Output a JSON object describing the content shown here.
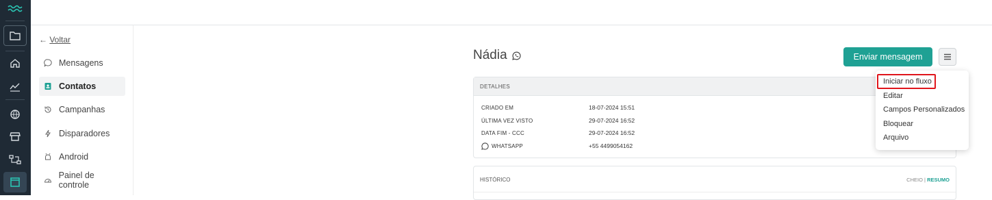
{
  "back": {
    "arrow": "←",
    "label": "Voltar"
  },
  "nav": [
    {
      "label": "Mensagens",
      "icon": "chat-bubble-icon",
      "active": false
    },
    {
      "label": "Contatos",
      "icon": "contact-card-icon",
      "active": true
    },
    {
      "label": "Campanhas",
      "icon": "history-icon",
      "active": false
    },
    {
      "label": "Disparadores",
      "icon": "lightning-icon",
      "active": false
    },
    {
      "label": "Android",
      "icon": "android-icon",
      "active": false
    },
    {
      "label": "Painel de controle",
      "icon": "dashboard-gauge-icon",
      "active": false
    }
  ],
  "contact": {
    "name": "Nádia"
  },
  "actions": {
    "send_label": "Enviar mensagem"
  },
  "details": {
    "header": "DETALHES",
    "rows": [
      {
        "label": "CRIADO EM",
        "value": "18-07-2024 15:51"
      },
      {
        "label": "ÚLTIMA VEZ VISTO",
        "value": "29-07-2024 16:52"
      },
      {
        "label": "DATA FIM - CCC",
        "value": "29-07-2024 16:52"
      },
      {
        "label": "WHATSAPP",
        "value": "+55 4499054162"
      }
    ]
  },
  "history": {
    "header": "HISTÓRICO",
    "full": "CHEIO",
    "sep": "|",
    "summary": "RESUMO"
  },
  "menu": {
    "items": [
      "Iniciar no fluxo",
      "Editar",
      "Campos Personalizados",
      "Bloquear",
      "Arquivo"
    ]
  },
  "colors": {
    "accent": "#1fa194",
    "rail": "#1f2a35",
    "highlight": "#e0151b"
  }
}
